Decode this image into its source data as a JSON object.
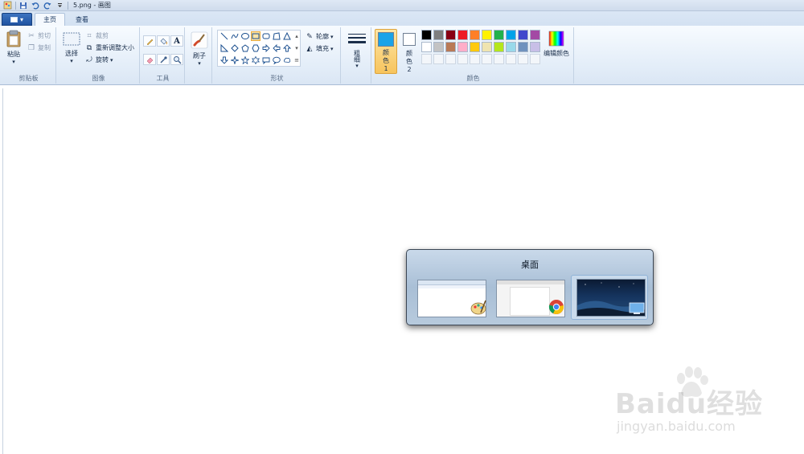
{
  "window": {
    "title": "5.png - 画图"
  },
  "quick_access": {
    "icons": [
      "paint-app-icon",
      "save-icon",
      "undo-icon",
      "redo-icon",
      "customize-dropdown-icon"
    ]
  },
  "tabs": [
    {
      "label": "主页",
      "active": true
    },
    {
      "label": "查看",
      "active": false
    }
  ],
  "ribbon": {
    "clipboard": {
      "label": "剪贴板",
      "paste": "粘贴",
      "cut": "剪切",
      "copy": "复制"
    },
    "image": {
      "label": "图像",
      "select": "选择",
      "crop": "裁剪",
      "resize": "重新调整大小",
      "rotate": "旋转"
    },
    "tools": {
      "label": "工具",
      "items": [
        "pencil-icon",
        "fill-bucket-icon",
        "text-tool-icon",
        "eraser-icon",
        "color-picker-icon",
        "magnifier-icon"
      ],
      "text_glyph": "A"
    },
    "brushes": {
      "label": "刷子"
    },
    "shapes": {
      "label": "形状",
      "outline": "轮廓",
      "fill": "填充"
    },
    "size": {
      "label": "粗细"
    },
    "colors": {
      "label": "颜色",
      "color1_label": "颜色 1",
      "color2_label": "颜色 2",
      "color1": "#1aa3e8",
      "color2": "#ffffff",
      "edit": "编辑颜色",
      "palette_row1": [
        "#000000",
        "#7f7f7f",
        "#880015",
        "#ed1c24",
        "#ff7f27",
        "#fff200",
        "#22b14c",
        "#00a2e8",
        "#3f48cc",
        "#a349a4"
      ],
      "palette_row2": [
        "#ffffff",
        "#c3c3c3",
        "#b97a57",
        "#ffaec9",
        "#ffc90e",
        "#efe4b0",
        "#b5e61d",
        "#99d9ea",
        "#7092be",
        "#c8bfe7"
      ]
    }
  },
  "switcher": {
    "title": "桌面",
    "thumbnails": [
      {
        "name": "paint-window"
      },
      {
        "name": "chrome-window"
      },
      {
        "name": "desktop"
      }
    ]
  },
  "watermark": {
    "logo": "Baidu经验",
    "url": "jingyan.baidu.com"
  }
}
